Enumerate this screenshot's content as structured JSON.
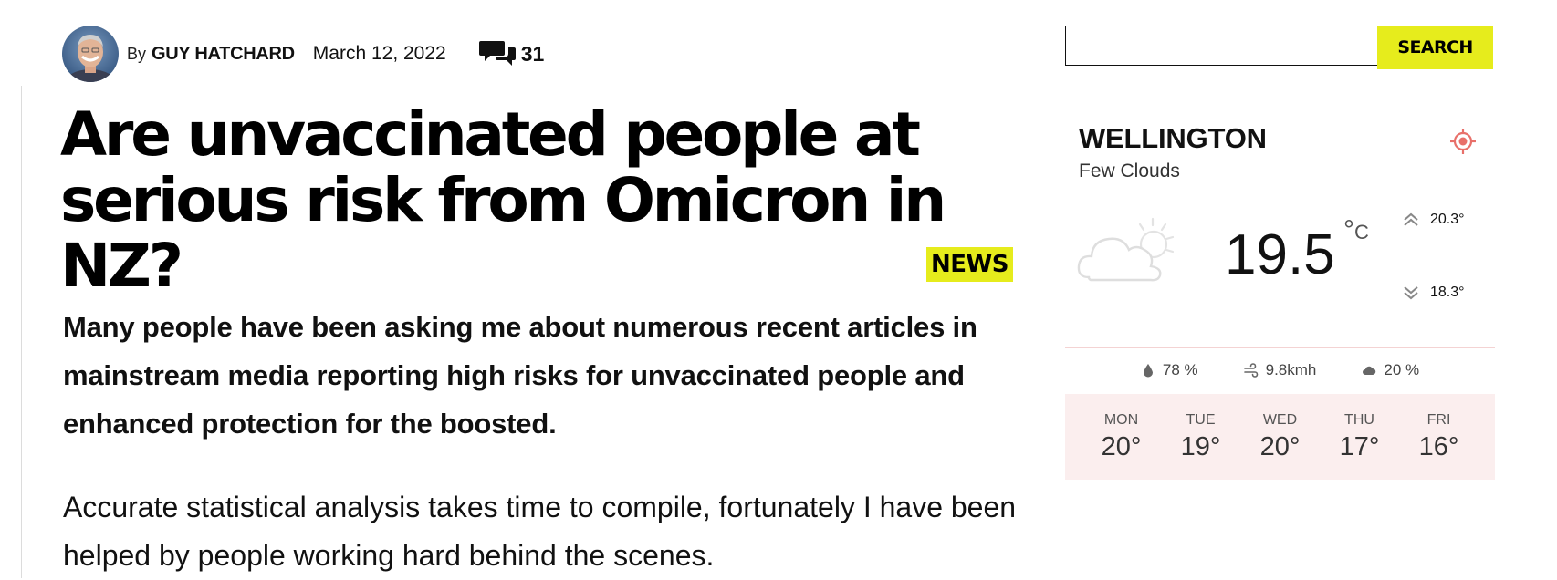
{
  "article": {
    "by_label": "By",
    "author": "GUY HATCHARD",
    "date": "March 12, 2022",
    "comment_count": "31",
    "title": "Are unvaccinated people at serious risk from Omicron in NZ?",
    "category": "NEWS",
    "lead": "Many people have been asking me about numerous recent articles in mainstream media reporting high risks for unvaccinated people and enhanced protection for the boosted.",
    "body_paragraph": "Accurate statistical analysis takes time to compile, fortunately I have been helped by people working hard behind the scenes."
  },
  "search": {
    "placeholder": "",
    "button_label": "SEARCH"
  },
  "weather": {
    "city": "WELLINGTON",
    "condition": "Few Clouds",
    "temperature": "19.5",
    "unit_degree": "°",
    "unit": "C",
    "high": "20.3°",
    "low": "18.3°",
    "humidity": "78 %",
    "wind": "9.8kmh",
    "clouds": "20 %",
    "forecast": [
      {
        "day": "MON",
        "temp": "20°"
      },
      {
        "day": "TUE",
        "temp": "19°"
      },
      {
        "day": "WED",
        "temp": "20°"
      },
      {
        "day": "THU",
        "temp": "17°"
      },
      {
        "day": "FRI",
        "temp": "16°"
      }
    ]
  },
  "colors": {
    "accent_yellow": "#e6ec1c",
    "locate_icon": "#e8706a",
    "forecast_bg": "#fbeeee"
  },
  "icons": {
    "comments": "speech-bubbles-icon",
    "locate": "crosshair-icon",
    "weather": "partly-cloudy-icon",
    "high": "chevron-up-double-icon",
    "low": "chevron-down-double-icon",
    "humidity": "droplet-icon",
    "wind": "wind-icon",
    "clouds": "cloud-icon"
  }
}
